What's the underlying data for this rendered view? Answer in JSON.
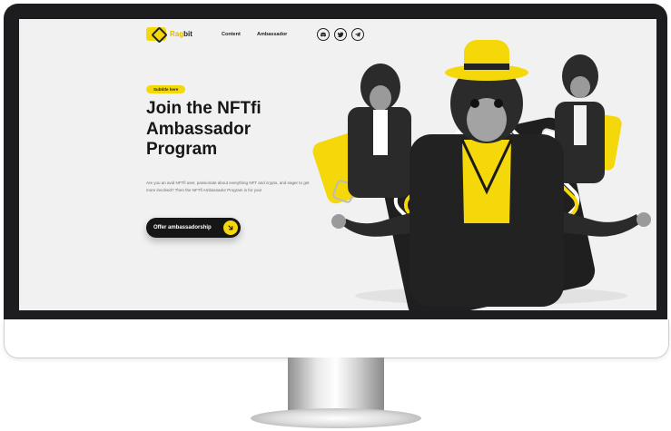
{
  "logo": {
    "prefix": "Rag",
    "suffix": "bit"
  },
  "nav": {
    "content": "Content",
    "ambassador": "Ambassador"
  },
  "social": [
    "discord-icon",
    "twitter-icon",
    "telegram-icon"
  ],
  "hero": {
    "badge": "Subtitle here",
    "title_line1": "Join the NFTfi",
    "title_line2": "Ambassador",
    "title_line3": "Program",
    "description": "Are you an avid NFTfi user, passionate about everything NFT and crypto, and eager to get more involved? Then the NFTfi Ambassador Program is for you!",
    "cta_label": "Offer ambassadorship"
  },
  "colors": {
    "accent": "#f5d80a",
    "dark": "#161616",
    "screen_bg": "#f1f1f1"
  }
}
